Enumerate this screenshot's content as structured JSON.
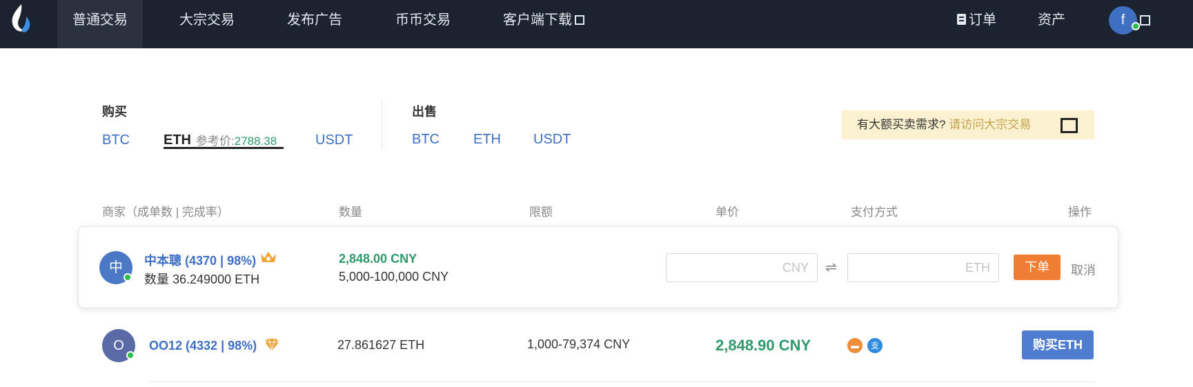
{
  "nav": {
    "items": [
      {
        "label": "普通交易"
      },
      {
        "label": "大宗交易"
      },
      {
        "label": "发布广告"
      },
      {
        "label": "币币交易"
      },
      {
        "label": "客户端下载"
      }
    ],
    "orders_label": "订单",
    "assets_label": "资产",
    "avatar_letter": "f"
  },
  "filters": {
    "buy_title": "购买",
    "buy_tabs": [
      "BTC",
      "ETH",
      "USDT"
    ],
    "ref_price_label": "参考价:",
    "ref_price_value": "2788.38",
    "sell_title": "出售",
    "sell_tabs": [
      "BTC",
      "ETH",
      "USDT"
    ]
  },
  "notice": {
    "text": "有大额买卖需求?",
    "link": "请访问大宗交易"
  },
  "table": {
    "headers": [
      "商家（成单数 | 完成率）",
      "数量",
      "限额",
      "单价",
      "支付方式",
      "操作"
    ]
  },
  "rows": [
    {
      "avatar": "中",
      "merchant": "中本聰 (4370 | 98%)",
      "quantity": "数量 36.249000 ETH",
      "price": "2,848.00 CNY",
      "limit": "5,000-100,000 CNY",
      "cny_placeholder": "CNY",
      "swap": "⇌",
      "eth_placeholder": "ETH",
      "order_button": "下单",
      "cancel": "取消"
    },
    {
      "avatar": "O",
      "merchant": "OO12 (4332 | 98%)",
      "quantity": "27.861627 ETH",
      "limit": "1,000-79,374 CNY",
      "price": "2,848.90 CNY",
      "payment_icons": [
        "bank-card-icon",
        "alipay-icon"
      ],
      "buy_button": "购买ETH"
    }
  ],
  "colors": {
    "nav_bg": "#1b2330",
    "link_blue": "#3c6fc5",
    "price_green": "#2e9a6c",
    "order_orange": "#ef7d33",
    "buy_blue": "#4f7ccf",
    "notice_bg": "#fbf1d0"
  }
}
